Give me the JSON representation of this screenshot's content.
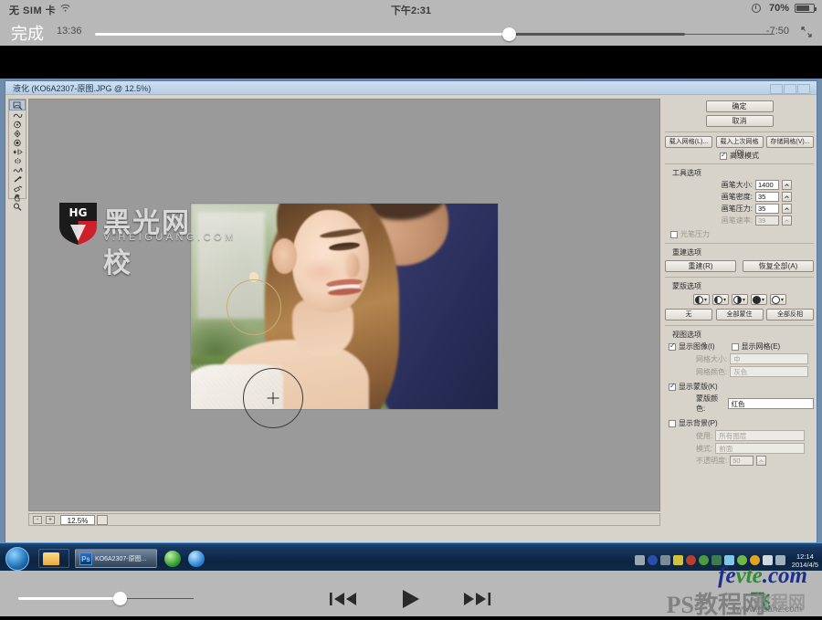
{
  "ios_player": {
    "status_bar": {
      "carrier": "无 SIM 卡",
      "wifi_icon": "wifi-icon",
      "clock": "下午2:31",
      "lock_icon": "rotation-lock-icon",
      "battery_percent": "70%",
      "battery_icon": "battery-icon"
    },
    "controls": {
      "done_label": "完成",
      "current_time": "13:36",
      "remaining_time": "-7:50",
      "expand_icon": "expand-icon",
      "scrubber_position_percent": 61
    },
    "bottom": {
      "volume_icon": "volume-slider",
      "volume_percent": 57,
      "prev_label": "skip-back-icon",
      "play_label": "play-icon",
      "next_label": "skip-forward-icon"
    }
  },
  "watermarks": {
    "logo_badge": "HG",
    "logo_text": "黑光网校",
    "logo_url": "V.HEIGUANG.COM",
    "fevte_blue": "fe",
    "fevte_green": "vte",
    "fevte_tail": ".com",
    "fei_text": "飞",
    "ps_text": "PS教程网",
    "ps_url": "www.psahz.com",
    "zhiwang_text": "教程网"
  },
  "photoshop": {
    "dialog_title": "液化 (KO6A2307-原图.JPG @ 12.5%)",
    "window_buttons": [
      "minimize",
      "maximize",
      "close"
    ],
    "toolbar": [
      {
        "name": "forward-warp-tool",
        "selected": true
      },
      {
        "name": "reconstruct-tool",
        "selected": false
      },
      {
        "name": "twirl-clockwise-tool",
        "selected": false
      },
      {
        "name": "pucker-tool",
        "selected": false
      },
      {
        "name": "bloat-tool",
        "selected": false
      },
      {
        "name": "push-left-tool",
        "selected": false
      },
      {
        "name": "mirror-tool",
        "selected": false
      },
      {
        "name": "turbulence-tool",
        "selected": false
      },
      {
        "name": "freeze-mask-tool",
        "selected": false
      },
      {
        "name": "thaw-mask-tool",
        "selected": false
      },
      {
        "name": "hand-tool",
        "selected": false
      },
      {
        "name": "zoom-tool",
        "selected": false
      }
    ],
    "canvas": {
      "zoom_minus": "-",
      "zoom_plus": "+",
      "zoom_value": "12.5%",
      "brush_cursor": "brush-cursor-circle"
    },
    "right_panel": {
      "ok_label": "确定",
      "cancel_label": "取消",
      "load_mesh_label": "载入网格(L)...",
      "load_last_mesh_label": "载入上次网格(O)",
      "save_mesh_label": "存储网格(V)...",
      "advanced_mode": {
        "label": "高级模式",
        "checked": true
      },
      "tool_options": {
        "title": "工具选项",
        "fields": [
          {
            "label": "画笔大小:",
            "value": "1400",
            "disabled": false
          },
          {
            "label": "画笔密度:",
            "value": "35",
            "disabled": false
          },
          {
            "label": "画笔压力:",
            "value": "35",
            "disabled": false
          },
          {
            "label": "画笔速率:",
            "value": "39",
            "disabled": true
          }
        ],
        "pen_pressure": {
          "label": "光笔压力",
          "checked": false
        }
      },
      "reconstruct_options": {
        "title": "重建选项",
        "reconstruct_label": "重建(R)",
        "restore_all_label": "恢复全部(A)"
      },
      "mask_options": {
        "title": "蒙版选项",
        "modes": [
          "replace-selection",
          "add-to-selection",
          "subtract-from-selection",
          "intersect-with-selection",
          "invert-selection"
        ],
        "none_label": "无",
        "mask_all_label": "全部蒙住",
        "invert_all_label": "全部反相"
      },
      "view_options": {
        "title": "视图选项",
        "show_image": {
          "label": "显示图像(I)",
          "checked": true
        },
        "show_mesh": {
          "label": "显示网格(E)",
          "checked": false
        },
        "mesh_size": {
          "label": "网格大小:",
          "value": "中",
          "disabled": true
        },
        "mesh_color": {
          "label": "网格颜色:",
          "value": "灰色",
          "disabled": true
        },
        "show_mask": {
          "label": "显示蒙版(K)",
          "checked": true
        },
        "mask_color": {
          "label": "蒙版颜色:",
          "value": "红色",
          "disabled": false
        },
        "show_backdrop": {
          "label": "显示背景(P)",
          "checked": false
        },
        "use": {
          "label": "使用:",
          "value": "所有图层",
          "disabled": true
        },
        "mode": {
          "label": "模式:",
          "value": "前面",
          "disabled": true
        },
        "opacity": {
          "label": "不透明度:",
          "value": "50",
          "disabled": true
        }
      }
    }
  },
  "windows_taskbar": {
    "start_button": "start-orb",
    "items": [
      {
        "name": "explorer-task",
        "label": ""
      },
      {
        "name": "photoshop-task",
        "label": "KO6A2307-原图...",
        "icon": "Ps",
        "active": true
      }
    ],
    "quick_icons": [
      "browser-icon",
      "globe-icon"
    ],
    "tray_time": "12:14",
    "tray_date": "2014/4/5"
  }
}
